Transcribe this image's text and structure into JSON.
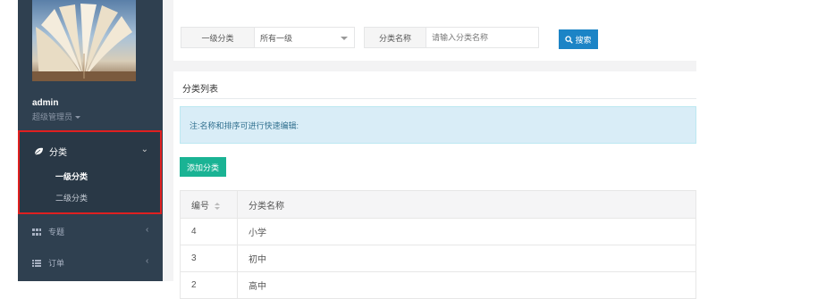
{
  "sidebar": {
    "user_name": "admin",
    "user_role": "超级管理员",
    "menu": {
      "category": {
        "label": "分类",
        "children": [
          "一级分类",
          "二级分类"
        ]
      },
      "topic": {
        "label": "专题"
      },
      "order": {
        "label": "订单"
      }
    }
  },
  "search": {
    "level_label": "一级分类",
    "level_value": "所有一级",
    "name_label": "分类名称",
    "name_placeholder": "请输入分类名称",
    "search_button": "搜索"
  },
  "list": {
    "title": "分类列表",
    "notice": "注:名称和排序可进行快速编辑:",
    "add_button": "添加分类",
    "columns": [
      "编号",
      "分类名称"
    ],
    "rows": [
      {
        "id": "4",
        "name": "小学"
      },
      {
        "id": "3",
        "name": "初中"
      },
      {
        "id": "2",
        "name": "高中"
      }
    ]
  },
  "colors": {
    "sidebar_bg": "#2f4050",
    "highlight": "#e02020",
    "primary_blue": "#1c84c6",
    "primary_green": "#1ab394",
    "notice_bg": "#d9edf7"
  },
  "icons": [
    "leaf-icon",
    "chevron-down-icon",
    "grid-icon",
    "list-icon",
    "chevron-left-icon",
    "search-icon",
    "sort-icon",
    "caret-down-icon"
  ]
}
